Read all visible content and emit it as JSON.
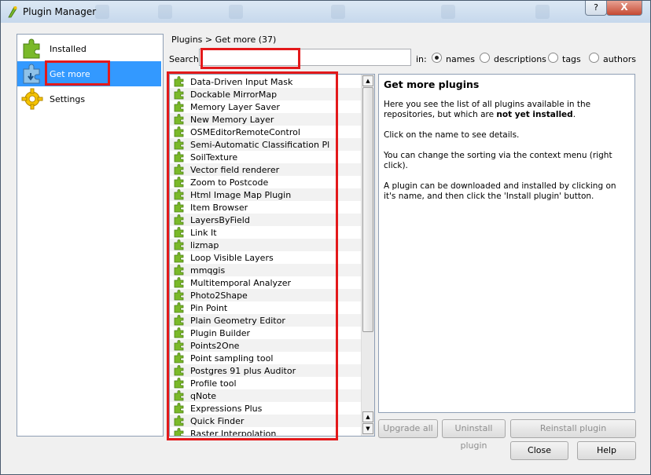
{
  "window": {
    "title": "Plugin Manager"
  },
  "titlebar": {
    "help_button": "?",
    "close_button": "X"
  },
  "sidebar": {
    "items": [
      {
        "label": "Installed",
        "icon": "puzzle-icon",
        "selected": false
      },
      {
        "label": "Get more",
        "icon": "puzzle-download-icon",
        "selected": true
      },
      {
        "label": "Settings",
        "icon": "gear-icon",
        "selected": false
      }
    ]
  },
  "header": {
    "breadcrumb": "Plugins > Get more (37)"
  },
  "search": {
    "label": "Search",
    "value": "",
    "placeholder": "",
    "in_label": "in:",
    "options": [
      {
        "label": "names",
        "checked": true
      },
      {
        "label": "descriptions",
        "checked": false
      },
      {
        "label": "tags",
        "checked": false
      },
      {
        "label": "authors",
        "checked": false
      }
    ]
  },
  "plugins": [
    "Data-Driven Input Mask",
    "Dockable MirrorMap",
    "Memory Layer Saver",
    "New Memory Layer",
    "OSMEditorRemoteControl",
    "Semi-Automatic Classification Pl",
    "SoilTexture",
    "Vector field renderer",
    "Zoom to Postcode",
    "Html Image Map Plugin",
    "Item Browser",
    "LayersByField",
    "Link It",
    "lizmap",
    "Loop Visible Layers",
    "mmqgis",
    "Multitemporal Analyzer",
    "Photo2Shape",
    "Pin Point",
    "Plain Geometry Editor",
    "Plugin Builder",
    "Points2One",
    "Point sampling tool",
    "Postgres 91 plus Auditor",
    "Profile tool",
    "qNote",
    "Expressions Plus",
    "Quick Finder",
    "Raster Interpolation"
  ],
  "details": {
    "heading": "Get more plugins",
    "p1_text": "Here you see the list of all plugins available in the repositories, but which are ",
    "p1_bold": "not yet installed",
    "p1_end": ".",
    "p2": "Click on the name to see details.",
    "p3": "You can change the sorting via the context menu (right click).",
    "p4": "A plugin can be downloaded and installed by clicking on it's name, and then click the 'Install plugin' button."
  },
  "buttons": {
    "upgrade_all": "Upgrade all",
    "uninstall": "Uninstall plugin",
    "reinstall": "Reinstall plugin",
    "close": "Close",
    "help": "Help"
  },
  "colors": {
    "highlight": "#e3191b",
    "selection": "#3399ff",
    "puzzle_green": "#7ab929"
  }
}
